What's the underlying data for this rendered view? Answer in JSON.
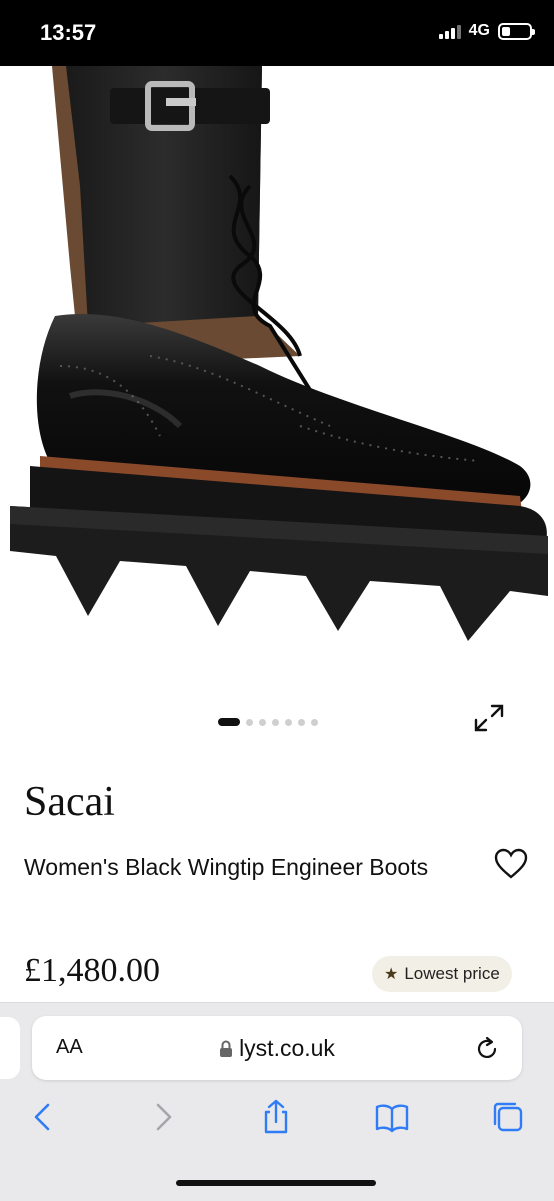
{
  "status_bar": {
    "time": "13:57",
    "network": "4G",
    "battery_level": 0.3
  },
  "carousel": {
    "total_images": 7,
    "active_index": 0
  },
  "product": {
    "brand": "Sacai",
    "name": "Women's Black Wingtip Engineer Boots",
    "price": "£1,480.00",
    "badge": "Lowest price"
  },
  "browser": {
    "text_size_label": "AA",
    "url": "lyst.co.uk"
  },
  "icons": {
    "expand": "expand-arrows-icon",
    "wishlist": "heart-outline-icon",
    "badge": "star-icon",
    "lock": "lock-icon",
    "reload": "reload-icon",
    "back": "back-chevron-icon",
    "forward": "forward-chevron-icon",
    "share": "share-icon",
    "bookmarks": "bookmarks-icon",
    "tabs": "tabs-icon"
  },
  "colors": {
    "accent_star": "#4a3b1c",
    "badge_bg": "#f1efe6",
    "ios_blue": "#2f7cf6"
  }
}
